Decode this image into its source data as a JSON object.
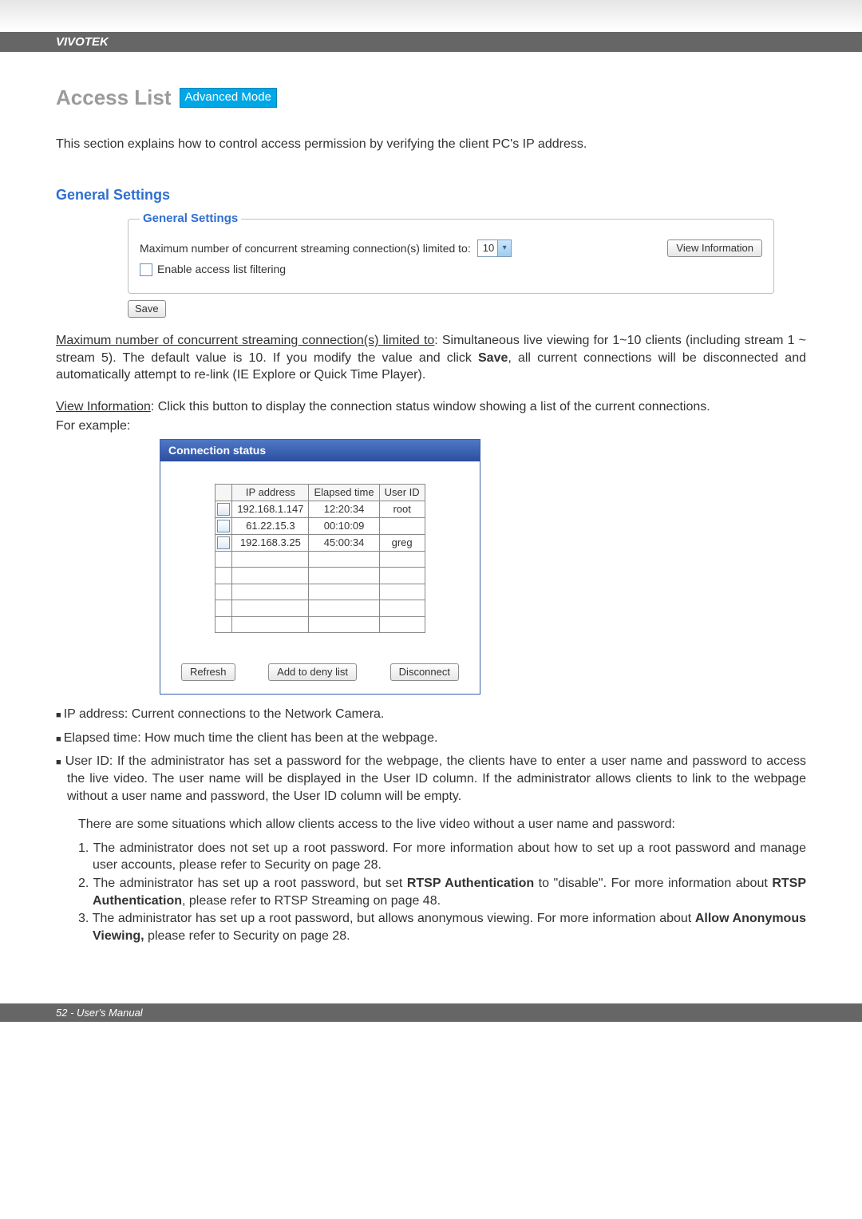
{
  "brand": "VIVOTEK",
  "page_title": "Access List",
  "mode_badge": "Advanced Mode",
  "intro": "This section explains how to control access permission by verifying the client PC's IP address.",
  "section_label": "General Settings",
  "fieldset_legend": "General Settings",
  "max_conn_label": "Maximum number of concurrent streaming connection(s) limited to:",
  "max_conn_value": "10",
  "view_info_btn": "View Information",
  "enable_filter_label": "Enable access list filtering",
  "save_btn": "Save",
  "para1_label": "Maximum number of concurrent streaming connection(s) limited to",
  "para1_body": ": Simultaneous live viewing for 1~10 clients (including stream 1 ~ stream 5). The default value is 10. If you modify the value and click ",
  "para1_save": "Save",
  "para1_tail": ", all current connections will be disconnected and automatically attempt to re-link (IE Explore or Quick Time Player).",
  "para2_label": "View Information",
  "para2_body": ": Click this button to display the connection status window showing a list of the current connections.",
  "for_example": "For example:",
  "conn_title": "Connection status",
  "conn_headers": [
    "",
    "IP address",
    "Elapsed time",
    "User ID"
  ],
  "conn_rows": [
    {
      "ip": "192.168.1.147",
      "elapsed": "12:20:34",
      "user": "root"
    },
    {
      "ip": "61.22.15.3",
      "elapsed": "00:10:09",
      "user": ""
    },
    {
      "ip": "192.168.3.25",
      "elapsed": "45:00:34",
      "user": "greg"
    }
  ],
  "blank_rows": 5,
  "refresh_btn": "Refresh",
  "deny_btn": "Add to deny list",
  "disconnect_btn": "Disconnect",
  "bullet_ip": "IP address: Current connections to the Network Camera.",
  "bullet_elapsed": "Elapsed time: How much time the client has been at the webpage.",
  "bullet_user_pre": "User ID: If the administrator has set a password for the webpage, the clients have to enter a user name and password to access the live video. The user name will be displayed in the User ID column. If  the administrator allows clients to link to the webpage without a user name and password, the User ID column will be empty.",
  "subpara": "There are some situations which allow clients access to the live video without a user name and password:",
  "num1": "1. The administrator does not set up a root password. For more information about how to set up a root password and manage user accounts, please refer to Security on page 28.",
  "num2_a": "2. The administrator has set up a root password, but set ",
  "num2_b": "RTSP Authentication",
  "num2_c": " to \"disable\". For more information about ",
  "num2_d": "RTSP Authentication",
  "num2_e": ", please refer to RTSP Streaming on page 48.",
  "num3_a": "3. The administrator has set up a root password, but allows anonymous viewing. For more information about ",
  "num3_b": "Allow Anonymous Viewing,",
  "num3_c": " please refer to Security on page 28.",
  "footer": "52 - User's Manual"
}
